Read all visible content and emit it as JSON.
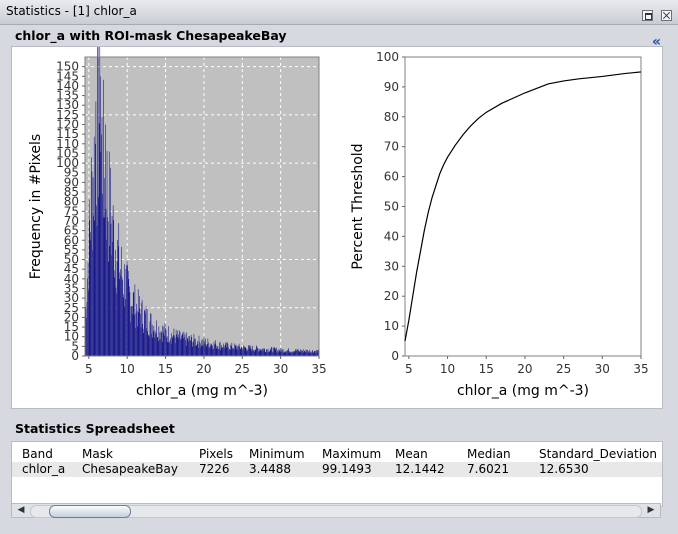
{
  "window": {
    "title": "Statistics - [1] chlor_a"
  },
  "section": {
    "title": "chlor_a with ROI-mask ChesapeakeBay"
  },
  "icons": {
    "collapse": "double-chevron-left-icon",
    "restore": "restore-icon",
    "close": "close-icon"
  },
  "colors": {
    "histogram_bars": "#1a1a8c",
    "histogram_bg": "#c0c0c0",
    "grid": "#ffffff",
    "cdf_line": "#000000"
  },
  "chart_data": [
    {
      "type": "bar",
      "xlabel": "chlor_a (mg m^-3)",
      "ylabel": "Frequency in #Pixels",
      "xlim": [
        4.5,
        35
      ],
      "ylim": [
        0,
        155
      ],
      "xticks": [
        5,
        10,
        15,
        20,
        25,
        30,
        35
      ],
      "yticks": [
        0,
        5,
        10,
        15,
        20,
        25,
        30,
        35,
        40,
        45,
        50,
        55,
        60,
        65,
        70,
        75,
        80,
        85,
        90,
        95,
        100,
        105,
        110,
        115,
        120,
        125,
        130,
        135,
        140,
        145,
        150
      ],
      "grid": true,
      "envelope": {
        "x": [
          4.5,
          5,
          5.5,
          6,
          6.3,
          6.6,
          7,
          7.5,
          8,
          8.5,
          9,
          9.5,
          10,
          11,
          12,
          13,
          14,
          15,
          17,
          20,
          23,
          26,
          30,
          35
        ],
        "y": [
          18,
          60,
          92,
          112,
          128,
          110,
          96,
          80,
          66,
          56,
          46,
          40,
          34,
          26,
          21,
          17,
          14,
          12,
          9,
          7,
          5,
          4,
          3,
          2.5
        ]
      },
      "peaks": [
        {
          "x": 6.45,
          "y": 145
        },
        {
          "x": 5.9,
          "y": 132
        },
        {
          "x": 7.1,
          "y": 120
        },
        {
          "x": 5.3,
          "y": 103
        }
      ]
    },
    {
      "type": "line",
      "xlabel": "chlor_a (mg m^-3)",
      "ylabel": "Percent Threshold",
      "xlim": [
        4.5,
        35
      ],
      "ylim": [
        0,
        100
      ],
      "xticks": [
        5,
        10,
        15,
        20,
        25,
        30,
        35
      ],
      "yticks": [
        0,
        10,
        20,
        30,
        40,
        50,
        60,
        70,
        80,
        90,
        100
      ],
      "grid": false,
      "x": [
        4.5,
        5,
        5.5,
        6,
        6.5,
        7,
        7.5,
        8,
        8.5,
        9,
        9.5,
        10,
        11,
        12,
        13,
        14,
        15,
        17,
        20,
        23,
        25,
        27,
        30,
        33,
        35
      ],
      "y": [
        5,
        12,
        20,
        28,
        35,
        42,
        48,
        53,
        57,
        61,
        64,
        66.5,
        70.5,
        74,
        77,
        79.5,
        81.5,
        84.5,
        88,
        91,
        92,
        92.7,
        93.5,
        94.5,
        95
      ]
    }
  ],
  "spreadsheet": {
    "title": "Statistics Spreadsheet",
    "headers": [
      "Band",
      "Mask",
      "Pixels",
      "Minimum",
      "Maximum",
      "Mean",
      "Median",
      "Standard_Deviation"
    ],
    "rows": [
      [
        "chlor_a",
        "ChesapeakeBay",
        "7226",
        "3.4488",
        "99.1493",
        "12.1442",
        "7.6021",
        "12.6530"
      ]
    ]
  },
  "scrollbar": {
    "left": "◀",
    "right": "▶"
  }
}
